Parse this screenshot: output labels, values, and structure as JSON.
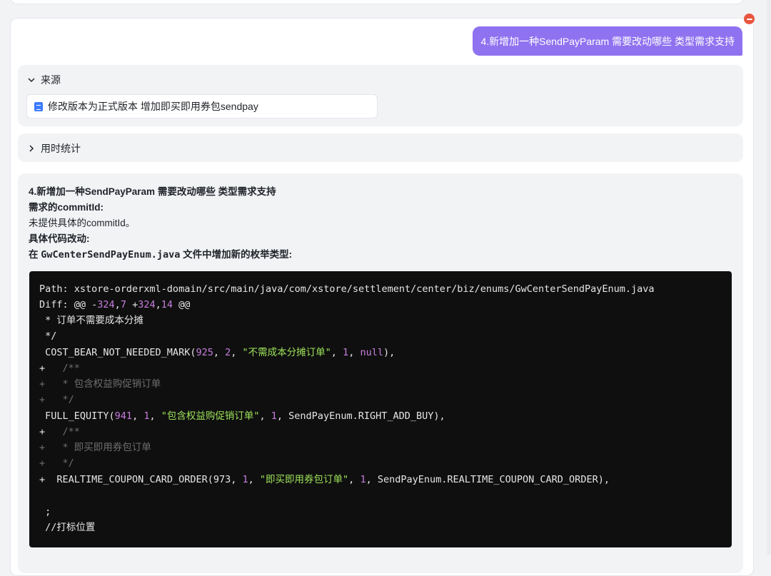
{
  "user_message": "4.新增加一种SendPayParam 需要改动哪些 类型需求支持",
  "sources": {
    "title": "来源",
    "items": [
      "修改版本为正式版本 增加即买即用券包sendpay"
    ]
  },
  "timing": {
    "title": "用时统计"
  },
  "answer": {
    "heading": "4.新增加一种SendPayParam 需要改动哪些 类型需求支持",
    "commit_label": "需求的commitId:",
    "commit_value": "未提供具体的commitId。",
    "code_change_label": "具体代码改动:",
    "file_prefix": "在 ",
    "file_name": "GwCenterSendPayEnum.java",
    "file_suffix": " 文件中增加新的枚举类型:"
  },
  "code": {
    "path_line": "Path: xstore-orderxml-domain/src/main/java/com/xstore/settlement/center/biz/enums/GwCenterSendPayEnum.java",
    "diff_prefix": "Diff: @@ -",
    "diff_a": "324",
    "diff_b": "7",
    "diff_c": "324",
    "diff_d": "14",
    "diff_suffix": " @@",
    "l3": " * 订单不需要成本分摊",
    "l4": " */",
    "l5_name": " COST_BEAR_NOT_NEEDED_MARK(",
    "l5_n1": "925",
    "l5_n2": "2",
    "l5_str": "\"不需成本分摊订单\"",
    "l5_n3": "1",
    "l5_null": "null",
    "l6": "  /**",
    "l7": "  * 包含权益购促销订单",
    "l8": "  */",
    "l9_name": " FULL_EQUITY(",
    "l9_n1": "941",
    "l9_n2": "1",
    "l9_str": "\"包含权益购促销订单\"",
    "l9_n3": "1",
    "l9_tail": "SendPayEnum.RIGHT_ADD_BUY),",
    "l10": "  /**",
    "l11": "  * 即买即用券包订单",
    "l12": "  */",
    "l13_name": "  REALTIME_COUPON_CARD_ORDER(",
    "l13_n1": "973",
    "l13_n2": "1",
    "l13_str": "\"即买即用券包订单\"",
    "l13_n3": "1",
    "l13_tail": "SendPayEnum.REALTIME_COUPON_CARD_ORDER),",
    "l15": " ;",
    "l16": " //打标位置"
  }
}
